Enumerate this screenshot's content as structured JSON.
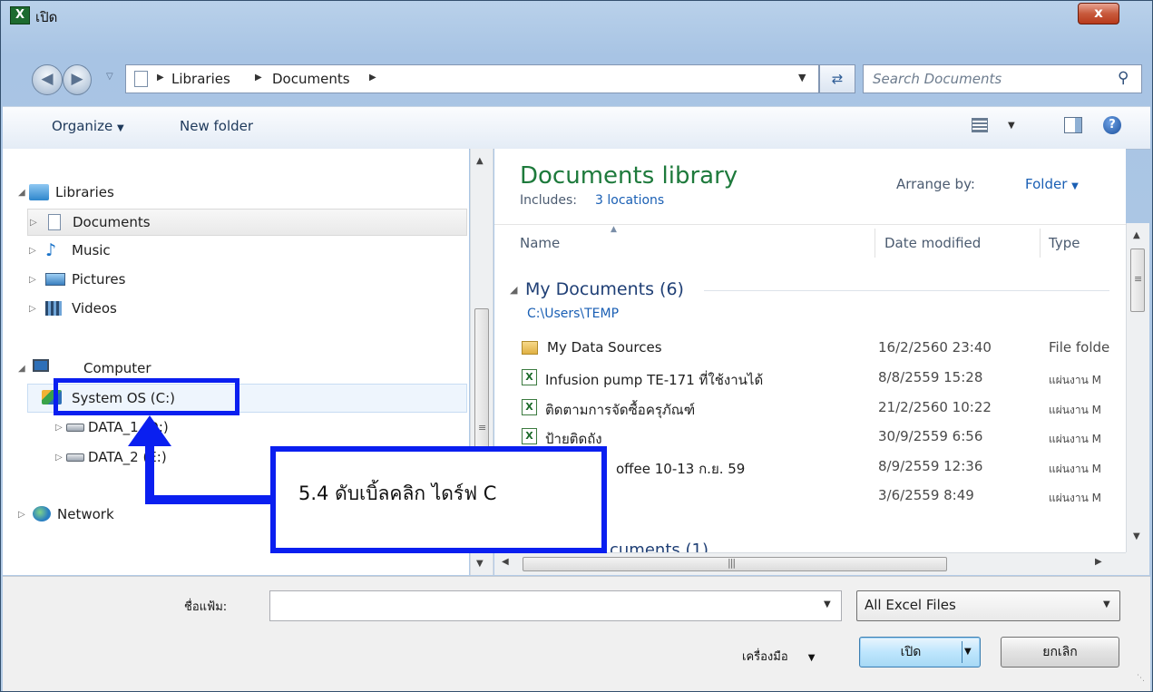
{
  "window": {
    "title": "เปิด",
    "close_label": "x"
  },
  "address": {
    "breadcrumb": [
      "Libraries",
      "Documents"
    ],
    "search_placeholder": "Search Documents"
  },
  "toolbar": {
    "organize_label": "Organize",
    "new_folder_label": "New folder"
  },
  "nav": {
    "libraries_label": "Libraries",
    "library_items": [
      "Documents",
      "Music",
      "Pictures",
      "Videos"
    ],
    "computer_label": "Computer",
    "drives": [
      "System OS (C:)",
      "DATA_1 (D:)",
      "DATA_2 (E:)"
    ],
    "network_label": "Network"
  },
  "content": {
    "library_title": "Documents library",
    "includes_label": "Includes:",
    "includes_link": "3 locations",
    "arrange_label": "Arrange by:",
    "arrange_value": "Folder",
    "columns": [
      "Name",
      "Date modified",
      "Type"
    ],
    "group_title": "My Documents (6)",
    "group_path": "C:\\Users\\TEMP",
    "files": [
      {
        "name": "My Data Sources",
        "date": "16/2/2560 23:40",
        "type": "File folde",
        "icon": "folder-icon"
      },
      {
        "name": "Infusion pump TE-171 ที่ใช้งานได้",
        "date": "8/8/2559 15:28",
        "type": "แผ่นงาน M",
        "icon": "excel-file-icon"
      },
      {
        "name": "ติดตามการจัดซื้อครุภัณฑ์",
        "date": "21/2/2560 10:22",
        "type": "แผ่นงาน M",
        "icon": "excel-file-icon"
      },
      {
        "name": "ป้ายติดถัง",
        "date": "30/9/2559 6:56",
        "type": "แผ่นงาน M",
        "icon": "excel-file-icon"
      },
      {
        "name": "offee 10-13 ก.ย. 59",
        "date": "8/9/2559 12:36",
        "type": "แผ่นงาน M",
        "icon": "excel-file-icon"
      },
      {
        "name": "",
        "date": "3/6/2559 8:49",
        "type": "แผ่นงาน M",
        "icon": "excel-file-icon"
      }
    ],
    "next_group_partial": "cuments (1)"
  },
  "bottom": {
    "filename_label": "ชื่อแฟ้ม:",
    "filename_value": "",
    "filter_value": "All Excel Files",
    "tools_label": "เครื่องมือ",
    "open_label": "เปิด",
    "cancel_label": "ยกเลิก"
  },
  "annotation": {
    "text": "5.4 ดับเบิ้ลคลิก ไดร์ฟ  C"
  },
  "colors": {
    "annotation_blue": "#0a1ff0",
    "heading_green": "#1e7a3c",
    "link_blue": "#1a5fb4"
  }
}
